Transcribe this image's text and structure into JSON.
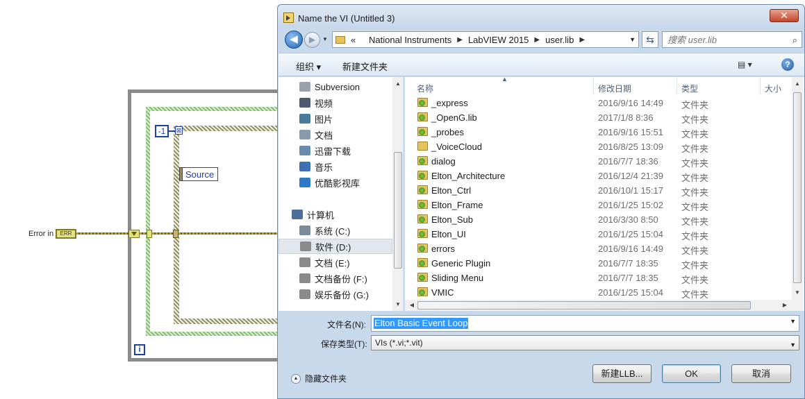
{
  "diagram": {
    "constant_value": "-1",
    "x_glyph": "⊠",
    "source_label": "Source",
    "error_in_label": "Error in",
    "error_terminal": "ERR",
    "iteration_label": "i"
  },
  "dialog": {
    "title": "Name the VI (Untitled 3)",
    "close_glyph": "✕",
    "address": {
      "prefix": "«",
      "crumbs": [
        "National Instruments",
        "LabVIEW 2015",
        "user.lib"
      ]
    },
    "search_placeholder": "搜索 user.lib",
    "toolbar": {
      "organize": "组织 ▾",
      "new_folder": "新建文件夹",
      "view_glyph": "▤ ▾",
      "help_glyph": "?"
    },
    "nav_items": [
      {
        "label": "Subversion",
        "icon": "svn-folder-icon",
        "color": "#9aa3ad"
      },
      {
        "label": "视频",
        "icon": "video-library-icon",
        "color": "#4a5a70"
      },
      {
        "label": "图片",
        "icon": "pictures-library-icon",
        "color": "#4a7a9a"
      },
      {
        "label": "文档",
        "icon": "documents-library-icon",
        "color": "#8a9aae"
      },
      {
        "label": "迅雷下载",
        "icon": "download-folder-icon",
        "color": "#6a8ab0"
      },
      {
        "label": "音乐",
        "icon": "music-library-icon",
        "color": "#3b6fb6"
      },
      {
        "label": "优酷影视库",
        "icon": "youku-library-icon",
        "color": "#2a7ac8"
      },
      {
        "label": "计算机",
        "icon": "computer-icon",
        "color": "#4d6f9a"
      },
      {
        "label": "系统 (C:)",
        "icon": "system-drive-icon",
        "color": "#7a8a9a"
      },
      {
        "label": "软件 (D:)",
        "icon": "drive-icon",
        "color": "#8a8a8a",
        "selected": true
      },
      {
        "label": "文档 (E:)",
        "icon": "drive-icon",
        "color": "#8a8a8a"
      },
      {
        "label": "文档备份 (F:)",
        "icon": "drive-icon",
        "color": "#8a8a8a"
      },
      {
        "label": "娱乐备份 (G:)",
        "icon": "drive-icon",
        "color": "#8a8a8a"
      }
    ],
    "columns": {
      "name": "名称",
      "date": "修改日期",
      "type": "类型",
      "size": "大小"
    },
    "files": [
      {
        "name": "_express",
        "date": "2016/9/16 14:49",
        "type": "文件夹",
        "green": true
      },
      {
        "name": "_OpenG.lib",
        "date": "2017/1/8 8:36",
        "type": "文件夹",
        "green": true
      },
      {
        "name": "_probes",
        "date": "2016/9/16 15:51",
        "type": "文件夹",
        "green": true
      },
      {
        "name": "_VoiceCloud",
        "date": "2016/8/25 13:09",
        "type": "文件夹",
        "green": false
      },
      {
        "name": "dialog",
        "date": "2016/7/7 18:36",
        "type": "文件夹",
        "green": true
      },
      {
        "name": "Elton_Architecture",
        "date": "2016/12/4 21:39",
        "type": "文件夹",
        "green": true
      },
      {
        "name": "Elton_Ctrl",
        "date": "2016/10/1 15:17",
        "type": "文件夹",
        "green": true
      },
      {
        "name": "Elton_Frame",
        "date": "2016/1/25 15:02",
        "type": "文件夹",
        "green": true
      },
      {
        "name": "Elton_Sub",
        "date": "2016/3/30 8:50",
        "type": "文件夹",
        "green": true
      },
      {
        "name": "Elton_UI",
        "date": "2016/1/25 15:04",
        "type": "文件夹",
        "green": true
      },
      {
        "name": "errors",
        "date": "2016/9/16 14:49",
        "type": "文件夹",
        "green": true
      },
      {
        "name": "Generic Plugin",
        "date": "2016/7/7 18:35",
        "type": "文件夹",
        "green": true
      },
      {
        "name": "Sliding Menu",
        "date": "2016/7/7 18:35",
        "type": "文件夹",
        "green": true
      },
      {
        "name": "VMIC",
        "date": "2016/1/25 15:04",
        "type": "文件夹",
        "green": true
      }
    ],
    "filename_label": "文件名(N):",
    "filename_value": "Elton Basic Event Loop",
    "filetype_label": "保存类型(T):",
    "filetype_value": "VIs (*.vi;*.vit)",
    "hide_folders": "隐藏文件夹",
    "buttons": {
      "new_llb": "新建LLB...",
      "ok": "OK",
      "cancel": "取消"
    }
  }
}
